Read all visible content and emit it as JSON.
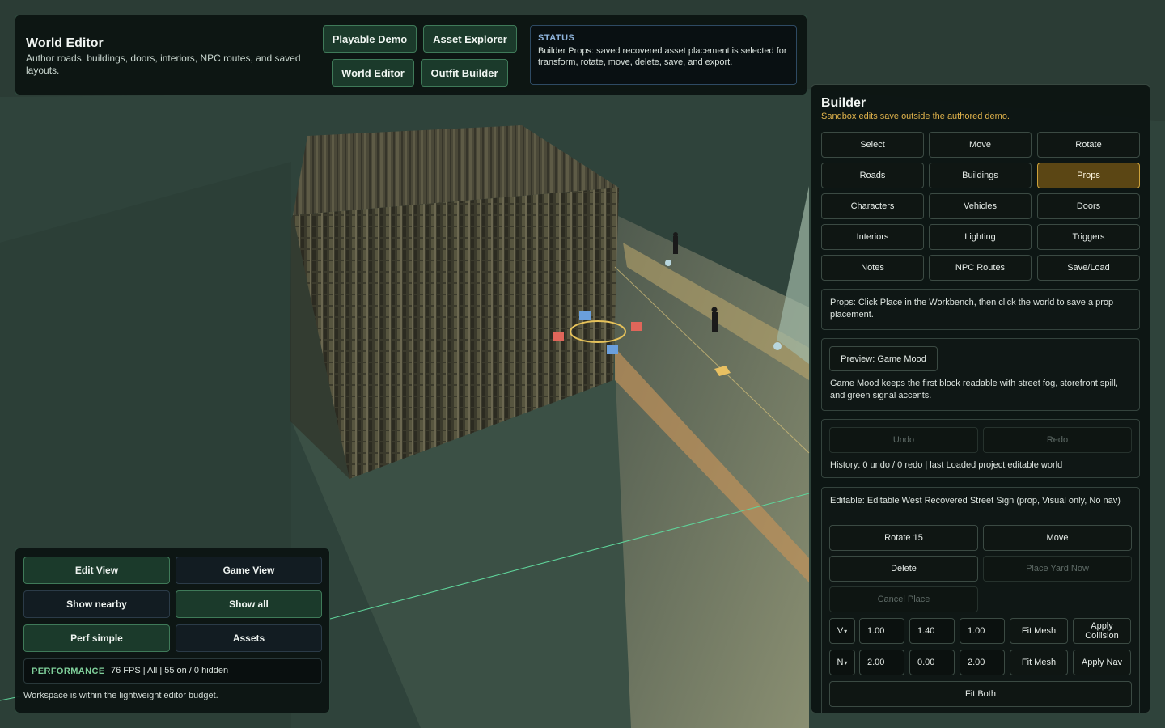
{
  "header": {
    "title": "World Editor",
    "subtitle": "Author roads, buildings, doors, interiors, NPC routes, and saved layouts.",
    "nav": [
      "Playable Demo",
      "Asset Explorer",
      "World Editor",
      "Outfit Builder"
    ],
    "status_label": "STATUS",
    "status_text": "Builder Props: saved recovered asset placement is selected for transform, rotate, move, delete, save, and export."
  },
  "view_panel": {
    "buttons": [
      {
        "label": "Edit View",
        "active": true
      },
      {
        "label": "Game View",
        "active": false
      },
      {
        "label": "Show nearby",
        "active": false
      },
      {
        "label": "Show all",
        "active": true
      },
      {
        "label": "Perf simple",
        "active": true
      },
      {
        "label": "Assets",
        "active": false
      }
    ],
    "performance_label": "PERFORMANCE",
    "performance_value": "76 FPS | All | 55 on / 0 hidden",
    "note": "Workspace is within the lightweight editor budget."
  },
  "builder": {
    "title": "Builder",
    "subtitle": "Sandbox edits save outside the authored demo.",
    "tools": [
      "Select",
      "Move",
      "Rotate",
      "Roads",
      "Buildings",
      "Props",
      "Characters",
      "Vehicles",
      "Doors",
      "Interiors",
      "Lighting",
      "Triggers",
      "Notes",
      "NPC Routes",
      "Save/Load"
    ],
    "active_tool": "Props",
    "hint": "Props: Click Place in the Workbench, then click the world to save a prop placement.",
    "preview_button": "Preview: Game Mood",
    "preview_text": "Game Mood keeps the first block readable with street fog, storefront spill, and green signal accents.",
    "undo": "Undo",
    "redo": "Redo",
    "history": "History: 0 undo / 0 redo | last Loaded project editable world",
    "editable_text": "Editable: Editable West Recovered Street Sign (prop, Visual only, No nav)",
    "actions": {
      "rotate": "Rotate 15",
      "move": "Move",
      "delete": "Delete",
      "place_yard": "Place Yard Now",
      "cancel_place": "Cancel Place"
    },
    "collision_row": {
      "select": "V",
      "x": "1.00",
      "y": "1.40",
      "z": "1.00",
      "fit": "Fit Mesh",
      "apply": "Apply Collision"
    },
    "nav_row": {
      "select": "N",
      "x": "2.00",
      "y": "0.00",
      "z": "2.00",
      "fit": "Fit Mesh",
      "apply": "Apply Nav"
    },
    "fit_both": "Fit Both"
  },
  "colors": {
    "accent_green": "#3f7a59",
    "active_tool": "#cda23a",
    "warning_text": "#e0b34c",
    "status_label": "#8fb4dc"
  }
}
